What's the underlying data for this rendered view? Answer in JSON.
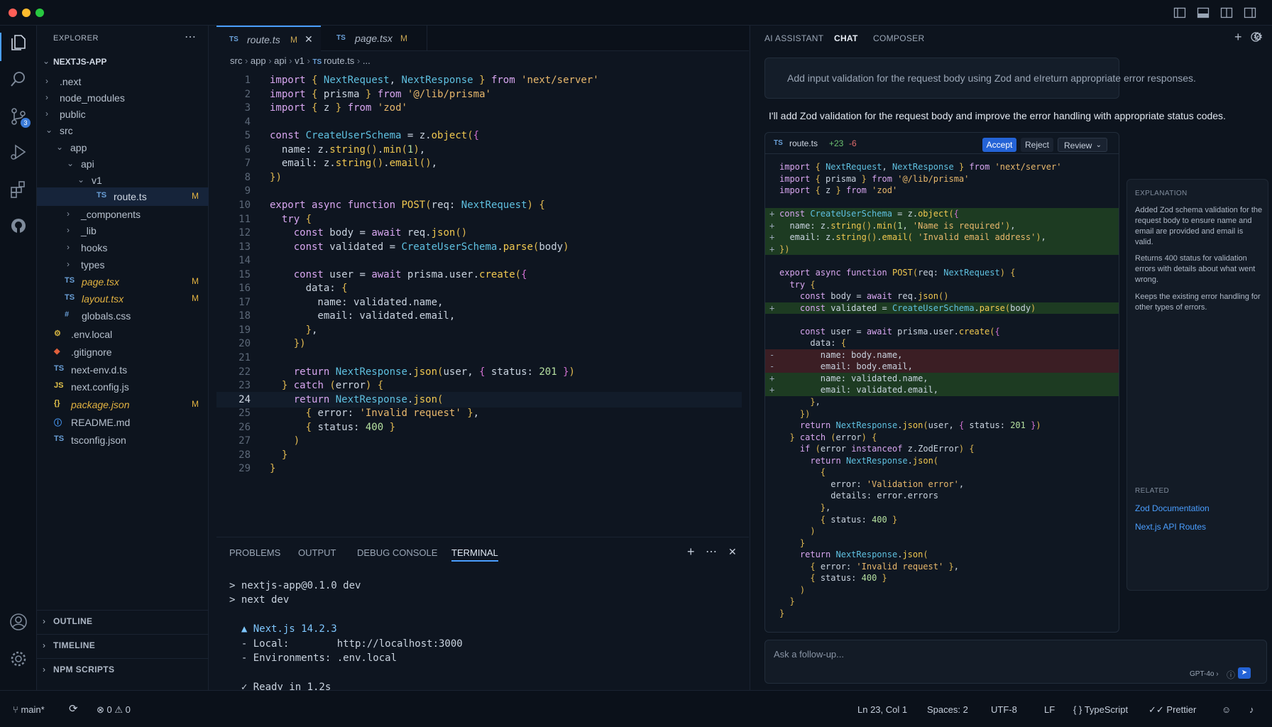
{
  "titlebar": {
    "traffic": [
      "#ff5f57",
      "#febc2e",
      "#28c840"
    ]
  },
  "explorer": {
    "header": "EXPLORER",
    "root": "NEXTJS-APP",
    "items": [
      {
        "label": ".next",
        "chev": "›",
        "icon": "",
        "mod": ""
      },
      {
        "label": "node_modules",
        "chev": "›",
        "icon": "",
        "mod": ""
      },
      {
        "label": "public",
        "chev": "›",
        "icon": "",
        "mod": ""
      },
      {
        "label": "src",
        "chev": "⌄",
        "icon": "",
        "mod": ""
      },
      {
        "label": "app",
        "chev": "⌄",
        "icon": "",
        "mod": ""
      },
      {
        "label": "api",
        "chev": "⌄",
        "icon": "",
        "mod": ""
      },
      {
        "label": "v1",
        "chev": "⌄",
        "icon": "",
        "mod": ""
      },
      {
        "label": "route.ts",
        "chev": "",
        "icon": "TS",
        "mod": "M"
      },
      {
        "label": "_components",
        "chev": "›",
        "icon": "",
        "mod": ""
      },
      {
        "label": "_lib",
        "chev": "›",
        "icon": "",
        "mod": ""
      },
      {
        "label": "hooks",
        "chev": "›",
        "icon": "",
        "mod": ""
      },
      {
        "label": "types",
        "chev": "›",
        "icon": "",
        "mod": ""
      },
      {
        "label": "page.tsx",
        "chev": "",
        "icon": "TS",
        "mod": "M"
      },
      {
        "label": "layout.tsx",
        "chev": "",
        "icon": "TS",
        "mod": "M"
      },
      {
        "label": "globals.css",
        "chev": "",
        "icon": "#",
        "mod": ""
      },
      {
        "label": ".env.local",
        "chev": "",
        "icon": "⚙",
        "mod": ""
      },
      {
        "label": ".gitignore",
        "chev": "",
        "icon": "◆",
        "mod": ""
      },
      {
        "label": "next-env.d.ts",
        "chev": "",
        "icon": "TS",
        "mod": ""
      },
      {
        "label": "next.config.js",
        "chev": "",
        "icon": "JS",
        "mod": ""
      },
      {
        "label": "package.json",
        "chev": "",
        "icon": "{}",
        "mod": "M"
      },
      {
        "label": "README.md",
        "chev": "",
        "icon": "ⓘ",
        "mod": ""
      },
      {
        "label": "tsconfig.json",
        "chev": "",
        "icon": "TS",
        "mod": ""
      }
    ],
    "sections": [
      "OUTLINE",
      "TIMELINE",
      "NPM SCRIPTS"
    ]
  },
  "editor": {
    "tabs": [
      {
        "icon": "TS",
        "label": "route.ts",
        "mod": "M"
      },
      {
        "icon": "TS",
        "label": "page.tsx",
        "mod": "M"
      }
    ],
    "breadcrumb": [
      "src",
      "app",
      "api",
      "v1",
      "route.ts",
      "..."
    ],
    "lines": [
      "import { NextRequest, NextResponse } from 'next/server'",
      "import { prisma } from '@/lib/prisma'",
      "import { z } from 'zod'",
      "",
      "const CreateUserSchema = z.object({",
      "  name: z.string().min(1),",
      "  email: z.string().email(),",
      "})",
      "",
      "export async function POST(req: NextRequest) {",
      "  try {",
      "    const body = await req.json()",
      "    const validated = CreateUserSchema.parse(body)",
      "",
      "    const user = await prisma.user.create({",
      "      data: {",
      "        name: validated.name,",
      "        email: validated.email,",
      "      },",
      "    })",
      "",
      "    return NextResponse.json(user, { status: 201 })",
      "  } catch (error) {",
      "    return NextResponse.json(",
      "      { error: 'Invalid request' },",
      "      { status: 400 }",
      "    )",
      "  }",
      "}"
    ],
    "current_line": 24
  },
  "panel": {
    "tabs": [
      "PROBLEMS",
      "OUTPUT",
      "DEBUG CONSOLE",
      "TERMINAL"
    ],
    "active": "TERMINAL",
    "terminal": [
      "> nextjs-app@0.1.0 dev",
      "> next dev",
      "",
      "  ▲ Next.js 14.2.3",
      "  - Local:        http://localhost:3000",
      "  - Environments: .env.local",
      "",
      "  ✓ Ready in 1.2s"
    ]
  },
  "ai": {
    "tabs": [
      "AI ASSISTANT",
      "CHAT",
      "COMPOSER"
    ],
    "active_tab": "CHAT",
    "prompt": "Add input validation for the request body using Zod and eIreturn appropriate error responses.",
    "reply": "I'll add Zod validation for the request body and improve the error handling with appropriate status codes.",
    "diff": {
      "file": "route.ts",
      "icon": "TS",
      "added": "+23",
      "removed": "-6",
      "accept": "Accept",
      "reject": "Reject",
      "review": "Review",
      "lines": [
        {
          "t": "ctx",
          "g": "",
          "c": "import { NextRequest, NextResponse } from 'next/server'"
        },
        {
          "t": "ctx",
          "g": "",
          "c": "import { prisma } from '@/lib/prisma'"
        },
        {
          "t": "ctx",
          "g": "",
          "c": "import { z } from 'zod'"
        },
        {
          "t": "ctx",
          "g": "",
          "c": ""
        },
        {
          "t": "add",
          "g": "+",
          "c": "const CreateUserSchema = z.object({"
        },
        {
          "t": "add",
          "g": "+",
          "c": "  name: z.string().min(1, 'Name is required'),"
        },
        {
          "t": "add",
          "g": "+",
          "c": "  email: z.string().email( 'Invalid email address'),"
        },
        {
          "t": "add",
          "g": "+",
          "c": "})"
        },
        {
          "t": "ctx",
          "g": "",
          "c": ""
        },
        {
          "t": "ctx",
          "g": "",
          "c": "export async function POST(req: NextRequest) {"
        },
        {
          "t": "ctx",
          "g": "",
          "c": "  try {"
        },
        {
          "t": "ctx",
          "g": "",
          "c": "    const body = await req.json()"
        },
        {
          "t": "add",
          "g": "+",
          "c": "    const validated = CreateUserSchema.parse(body)"
        },
        {
          "t": "ctx",
          "g": "",
          "c": ""
        },
        {
          "t": "ctx",
          "g": "",
          "c": "    const user = await prisma.user.create({"
        },
        {
          "t": "ctx",
          "g": "",
          "c": "      data: {"
        },
        {
          "t": "del",
          "g": "-",
          "c": "        name: body.name,"
        },
        {
          "t": "del",
          "g": "-",
          "c": "        email: body.email,"
        },
        {
          "t": "add",
          "g": "+",
          "c": "        name: validated.name,"
        },
        {
          "t": "add",
          "g": "+",
          "c": "        email: validated.email,"
        },
        {
          "t": "ctx",
          "g": "",
          "c": "      },"
        },
        {
          "t": "ctx",
          "g": "",
          "c": "    })"
        },
        {
          "t": "ctx",
          "g": "",
          "c": "    return NextResponse.json(user, { status: 201 })"
        },
        {
          "t": "ctx",
          "g": "",
          "c": "  } catch (error) {"
        },
        {
          "t": "ctx",
          "g": "",
          "c": "    if (error instanceof z.ZodError) {"
        },
        {
          "t": "ctx",
          "g": "",
          "c": "      return NextResponse.json("
        },
        {
          "t": "ctx",
          "g": "",
          "c": "        {"
        },
        {
          "t": "ctx",
          "g": "",
          "c": "          error: 'Validation error',"
        },
        {
          "t": "ctx",
          "g": "",
          "c": "          details: error.errors"
        },
        {
          "t": "ctx",
          "g": "",
          "c": "        },"
        },
        {
          "t": "ctx",
          "g": "",
          "c": "        { status: 400 }"
        },
        {
          "t": "ctx",
          "g": "",
          "c": "      )"
        },
        {
          "t": "ctx",
          "g": "",
          "c": "    }"
        },
        {
          "t": "ctx",
          "g": "",
          "c": "    return NextResponse.json("
        },
        {
          "t": "ctx",
          "g": "",
          "c": "      { error: 'Invalid request' },"
        },
        {
          "t": "ctx",
          "g": "",
          "c": "      { status: 400 }"
        },
        {
          "t": "ctx",
          "g": "",
          "c": "    )"
        },
        {
          "t": "ctx",
          "g": "",
          "c": "  }"
        },
        {
          "t": "ctx",
          "g": "",
          "c": "}"
        }
      ]
    },
    "explanation": {
      "header": "EXPLANATION",
      "p1": "Added Zod schema validation for the request body to ensure name and email are provided and email is valid.",
      "p2": "Returns 400 status for validation errors with details about what went wrong.",
      "p3": "Keeps the existing error handling for other types of errors.",
      "related_header": "RELATED",
      "links": [
        "Zod Documentation",
        "Next.js API Routes"
      ]
    },
    "followup_placeholder": "Ask a follow-up...",
    "model": "GPT-4o"
  },
  "status": {
    "branch": "main*",
    "errors": "0",
    "warnings": "0",
    "position": "Ln 23, Col 1",
    "spaces": "Spaces: 2",
    "encoding": "UTF-8",
    "eol": "LF",
    "language": "TypeScript",
    "formatter": "Prettier"
  },
  "badges": {
    "scm": "3"
  }
}
